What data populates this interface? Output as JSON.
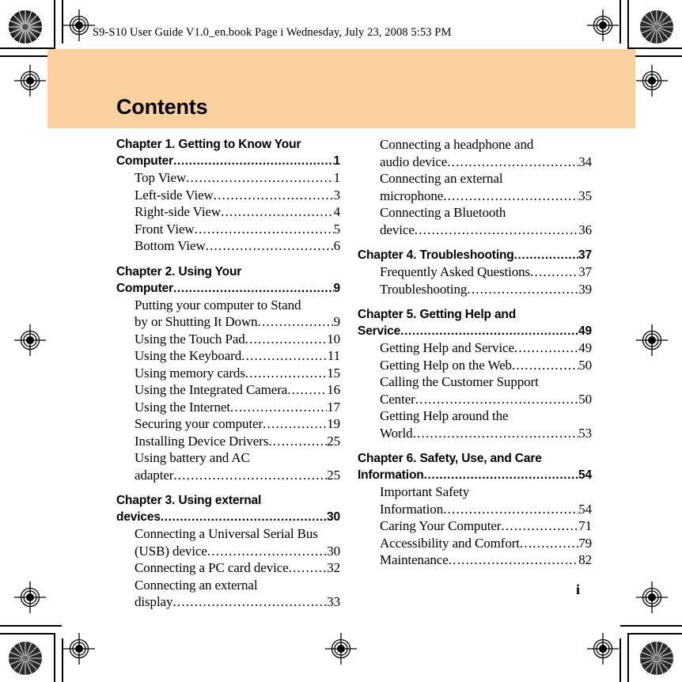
{
  "file_header": "S9-S10 User Guide V1.0_en.book  Page i  Wednesday, July 23, 2008  5:53 PM",
  "title": "Contents",
  "folio": "i",
  "colors": {
    "band": "#fbd0a0",
    "text": "#000000",
    "page": "#ffffff"
  },
  "marks": {
    "rosette_top_left": "rosette-mark",
    "rosette_top_right": "rosette-mark",
    "rosette_bottom_left": "rosette-mark",
    "rosette_bottom_right": "rosette-mark",
    "registration_targets": "registration-target"
  },
  "toc": {
    "left_column": [
      {
        "level": "chapter",
        "lines": [
          "Chapter 1. Getting to Know Your",
          "Computer"
        ],
        "page": "1"
      },
      {
        "level": "section",
        "lines": [
          "Top View"
        ],
        "page": "1"
      },
      {
        "level": "section",
        "lines": [
          "Left-side View"
        ],
        "page": "3"
      },
      {
        "level": "section",
        "lines": [
          "Right-side View"
        ],
        "page": "4"
      },
      {
        "level": "section",
        "lines": [
          "Front View"
        ],
        "page": "5"
      },
      {
        "level": "section",
        "lines": [
          "Bottom View"
        ],
        "page": "6"
      },
      {
        "level": "chapter",
        "lines": [
          "Chapter 2. Using Your",
          "Computer"
        ],
        "page": "9"
      },
      {
        "level": "section",
        "lines": [
          "Putting your computer to Stand",
          "by or Shutting It Down"
        ],
        "page": "9"
      },
      {
        "level": "section",
        "lines": [
          "Using the Touch Pad"
        ],
        "page": "10"
      },
      {
        "level": "section",
        "lines": [
          "Using the Keyboard"
        ],
        "page": "11"
      },
      {
        "level": "section",
        "lines": [
          "Using memory cards"
        ],
        "page": "15"
      },
      {
        "level": "section",
        "lines": [
          "Using the Integrated Camera"
        ],
        "page": "16"
      },
      {
        "level": "section",
        "lines": [
          "Using the Internet"
        ],
        "page": "17"
      },
      {
        "level": "section",
        "lines": [
          "Securing your computer"
        ],
        "page": "19"
      },
      {
        "level": "section",
        "lines": [
          "Installing Device Drivers"
        ],
        "page": "25"
      },
      {
        "level": "section",
        "lines": [
          "Using battery and AC",
          "adapter"
        ],
        "page": "25"
      },
      {
        "level": "chapter",
        "lines": [
          "Chapter 3. Using external",
          "devices"
        ],
        "page": "30"
      },
      {
        "level": "section",
        "lines": [
          "Connecting a Universal Serial Bus",
          "(USB) device"
        ],
        "page": "30"
      },
      {
        "level": "section",
        "lines": [
          "Connecting a PC card device"
        ],
        "page": "32"
      },
      {
        "level": "section",
        "lines": [
          "Connecting an external",
          "display"
        ],
        "page": "33"
      }
    ],
    "right_column": [
      {
        "level": "section",
        "lines": [
          "Connecting a headphone and",
          "audio device"
        ],
        "page": "34"
      },
      {
        "level": "section",
        "lines": [
          "Connecting an external",
          "microphone"
        ],
        "page": "35"
      },
      {
        "level": "section",
        "lines": [
          "Connecting a Bluetooth",
          "device"
        ],
        "page": "36"
      },
      {
        "level": "chapter",
        "lines": [
          "Chapter 4. Troubleshooting"
        ],
        "page": "37"
      },
      {
        "level": "section",
        "lines": [
          "Frequently Asked Questions"
        ],
        "page": "37"
      },
      {
        "level": "section",
        "lines": [
          "Troubleshooting"
        ],
        "page": "39"
      },
      {
        "level": "chapter",
        "lines": [
          "Chapter 5. Getting Help and",
          "Service"
        ],
        "page": "49"
      },
      {
        "level": "section",
        "lines": [
          "Getting Help and Service"
        ],
        "page": "49"
      },
      {
        "level": "section",
        "lines": [
          "Getting Help on the Web"
        ],
        "page": "50"
      },
      {
        "level": "section",
        "lines": [
          "Calling the Customer Support",
          "Center"
        ],
        "page": "50"
      },
      {
        "level": "section",
        "lines": [
          "Getting Help around the",
          "World"
        ],
        "page": "53"
      },
      {
        "level": "chapter",
        "lines": [
          "Chapter 6. Safety, Use, and Care",
          "Information"
        ],
        "page": "54"
      },
      {
        "level": "section",
        "lines": [
          "Important Safety",
          "Information"
        ],
        "page": "54"
      },
      {
        "level": "section",
        "lines": [
          "Caring Your Computer"
        ],
        "page": "71"
      },
      {
        "level": "section",
        "lines": [
          "Accessibility and Comfort"
        ],
        "page": "79"
      },
      {
        "level": "section",
        "lines": [
          "Maintenance"
        ],
        "page": "82"
      }
    ]
  }
}
